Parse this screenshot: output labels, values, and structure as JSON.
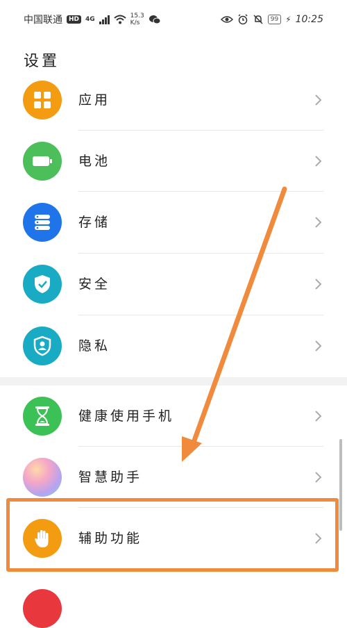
{
  "status_bar": {
    "carrier": "中国联通",
    "hd": "HD",
    "network": "4G",
    "speed_value": "15.3",
    "speed_unit": "K/s",
    "battery": "99",
    "time": "10:25"
  },
  "page": {
    "title": "设置"
  },
  "settings": [
    {
      "label": "应用",
      "icon": "apps-grid-icon",
      "color": "#f39c12"
    },
    {
      "label": "电池",
      "icon": "battery-icon",
      "color": "#4cbf5a"
    },
    {
      "label": "存储",
      "icon": "storage-icon",
      "color": "#1e74e8"
    },
    {
      "label": "安全",
      "icon": "shield-icon",
      "color": "#1aabc4"
    },
    {
      "label": "隐私",
      "icon": "privacy-icon",
      "color": "#1aabc4"
    },
    {
      "label": "健康使用手机",
      "icon": "hourglass-icon",
      "color": "#3cc157"
    },
    {
      "label": "智慧助手",
      "icon": "assistant-icon",
      "color": "#c7a6e8"
    },
    {
      "label": "辅助功能",
      "icon": "hand-icon",
      "color": "#f39c12"
    }
  ],
  "annotation": {
    "highlight_color": "#f08a3c"
  }
}
